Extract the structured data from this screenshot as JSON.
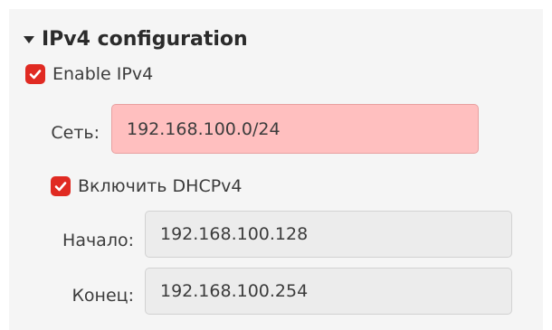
{
  "section": {
    "title": "IPv4 configuration",
    "expander_icon": "triangle-down-icon"
  },
  "enable_ipv4": {
    "label": "Enable IPv4",
    "checked": true,
    "color": "#e02a22"
  },
  "network": {
    "label": "Сеть:",
    "value": "192.168.100.0/24",
    "state": "error",
    "background": "#ffbfbf"
  },
  "dhcp": {
    "label": "Включить DHCPv4",
    "checked": true
  },
  "range_start": {
    "label": "Начало:",
    "value": "192.168.100.128"
  },
  "range_end": {
    "label": "Конец:",
    "value": "192.168.100.254"
  }
}
